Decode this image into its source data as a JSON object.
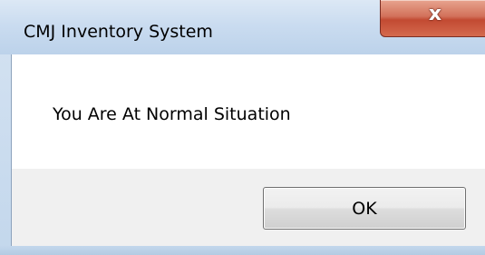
{
  "dialog": {
    "title": "CMJ Inventory System",
    "close_glyph": "x",
    "message": "You Are At Normal Situation",
    "ok_label": "OK"
  },
  "icons": {
    "close": "close-icon"
  },
  "colors": {
    "frame": "#c3d7ec",
    "close_button": "#c24a32",
    "client_background": "#f0f0f0",
    "message_background": "#ffffff"
  }
}
